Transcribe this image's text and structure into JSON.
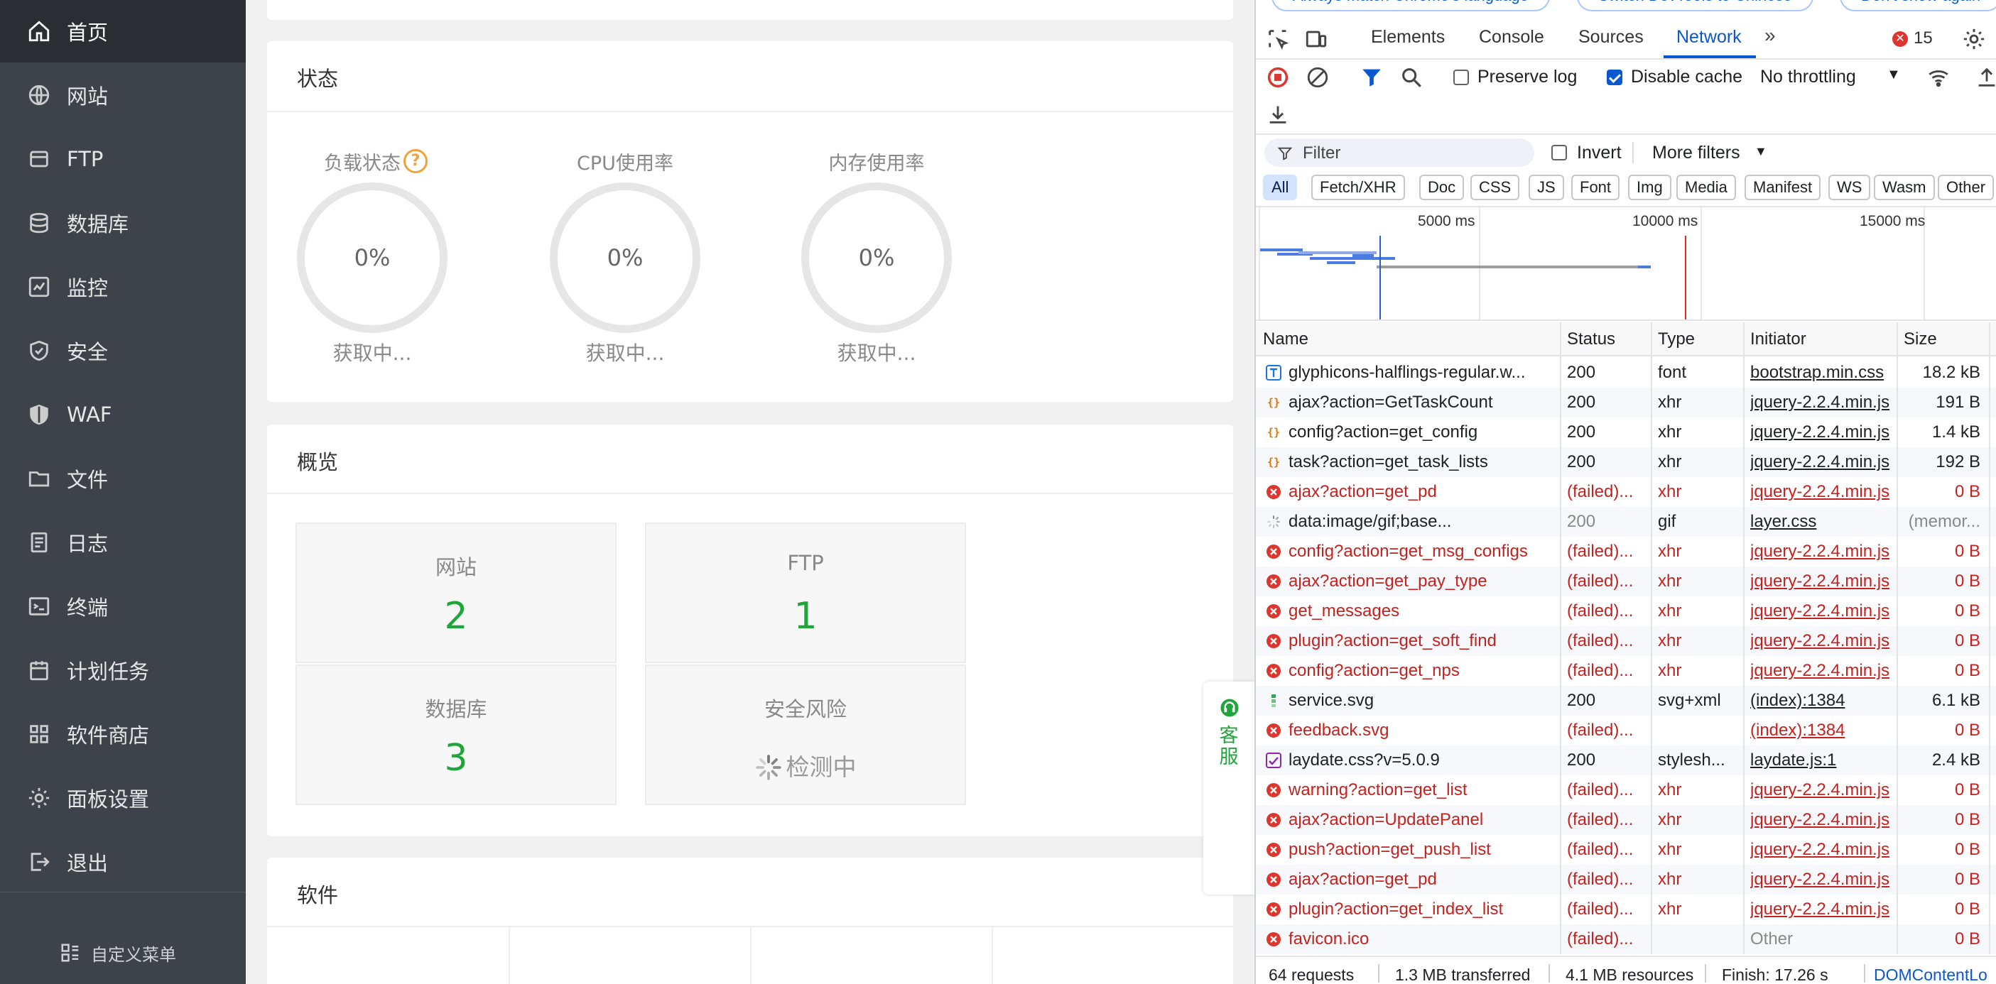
{
  "sidebar": {
    "items": [
      {
        "label": "首页",
        "icon": "home-icon"
      },
      {
        "label": "网站",
        "icon": "globe-icon"
      },
      {
        "label": "FTP",
        "icon": "ftp-icon"
      },
      {
        "label": "数据库",
        "icon": "database-icon"
      },
      {
        "label": "监控",
        "icon": "monitor-icon"
      },
      {
        "label": "安全",
        "icon": "shield-check-icon"
      },
      {
        "label": "WAF",
        "icon": "waf-shield-icon"
      },
      {
        "label": "文件",
        "icon": "folder-icon"
      },
      {
        "label": "日志",
        "icon": "log-icon"
      },
      {
        "label": "终端",
        "icon": "terminal-icon"
      },
      {
        "label": "计划任务",
        "icon": "calendar-icon"
      },
      {
        "label": "软件商店",
        "icon": "grid-icon"
      },
      {
        "label": "面板设置",
        "icon": "gear-icon"
      },
      {
        "label": "退出",
        "icon": "logout-icon"
      }
    ],
    "custom_menu": "自定义菜单"
  },
  "status": {
    "title": "状态",
    "gauges": [
      {
        "title": "负载状态",
        "value": "0%",
        "status": "获取中..."
      },
      {
        "title": "CPU使用率",
        "value": "0%",
        "status": "获取中..."
      },
      {
        "title": "内存使用率",
        "value": "0%",
        "status": "获取中..."
      }
    ]
  },
  "overview": {
    "title": "概览",
    "boxes": [
      {
        "label": "网站",
        "value": "2"
      },
      {
        "label": "FTP",
        "value": "1"
      },
      {
        "label": "数据库",
        "value": "3"
      },
      {
        "label": "安全风险",
        "value": "检测中"
      }
    ]
  },
  "software": {
    "title": "软件"
  },
  "kefu": {
    "text1": "客",
    "text2": "服"
  },
  "devtools": {
    "top_pills": [
      "Always match Chrome's language",
      "Switch DevTools to Chinese",
      "Don't show again"
    ],
    "tabs": [
      "Elements",
      "Console",
      "Sources",
      "Network"
    ],
    "active_tab": "Network",
    "error_count": "15",
    "preserve_log": "Preserve log",
    "disable_cache": "Disable cache",
    "throttling": "No throttling",
    "filter_placeholder": "Filter",
    "invert": "Invert",
    "more_filters": "More filters",
    "type_filters": [
      "All",
      "Fetch/XHR",
      "Doc",
      "CSS",
      "JS",
      "Font",
      "Img",
      "Media",
      "Manifest",
      "WS",
      "Wasm",
      "Other"
    ],
    "timeline_ticks": [
      "5000 ms",
      "10000 ms",
      "15000 ms"
    ],
    "columns": [
      "Name",
      "Status",
      "Type",
      "Initiator",
      "Size"
    ],
    "rows": [
      {
        "name": "glyphicons-halflings-regular.w...",
        "status": "200",
        "type": "font",
        "initiator": "bootstrap.min.css",
        "size": "18.2 kB",
        "kind": "font",
        "failed": false
      },
      {
        "name": "ajax?action=GetTaskCount",
        "status": "200",
        "type": "xhr",
        "initiator": "jquery-2.2.4.min.js",
        "size": "191 B",
        "kind": "xhr",
        "failed": false
      },
      {
        "name": "config?action=get_config",
        "status": "200",
        "type": "xhr",
        "initiator": "jquery-2.2.4.min.js",
        "size": "1.4 kB",
        "kind": "xhr",
        "failed": false
      },
      {
        "name": "task?action=get_task_lists",
        "status": "200",
        "type": "xhr",
        "initiator": "jquery-2.2.4.min.js",
        "size": "192 B",
        "kind": "xhr",
        "failed": false
      },
      {
        "name": "ajax?action=get_pd",
        "status": "(failed)...",
        "type": "xhr",
        "initiator": "jquery-2.2.4.min.js",
        "size": "0 B",
        "kind": "error",
        "failed": true
      },
      {
        "name": "data:image/gif;base...",
        "status": "200",
        "type": "gif",
        "initiator": "layer.css",
        "size": "(memor...",
        "kind": "gif",
        "failed": false
      },
      {
        "name": "config?action=get_msg_configs",
        "status": "(failed)...",
        "type": "xhr",
        "initiator": "jquery-2.2.4.min.js",
        "size": "0 B",
        "kind": "error",
        "failed": true
      },
      {
        "name": "ajax?action=get_pay_type",
        "status": "(failed)...",
        "type": "xhr",
        "initiator": "jquery-2.2.4.min.js",
        "size": "0 B",
        "kind": "error",
        "failed": true
      },
      {
        "name": "get_messages",
        "status": "(failed)...",
        "type": "xhr",
        "initiator": "jquery-2.2.4.min.js",
        "size": "0 B",
        "kind": "error",
        "failed": true
      },
      {
        "name": "plugin?action=get_soft_find",
        "status": "(failed)...",
        "type": "xhr",
        "initiator": "jquery-2.2.4.min.js",
        "size": "0 B",
        "kind": "error",
        "failed": true
      },
      {
        "name": "config?action=get_nps",
        "status": "(failed)...",
        "type": "xhr",
        "initiator": "jquery-2.2.4.min.js",
        "size": "0 B",
        "kind": "error",
        "failed": true
      },
      {
        "name": "service.svg",
        "status": "200",
        "type": "svg+xml",
        "initiator": "(index):1384",
        "size": "6.1 kB",
        "kind": "svg",
        "failed": false
      },
      {
        "name": "feedback.svg",
        "status": "(failed)...",
        "type": "",
        "initiator": "(index):1384",
        "size": "0 B",
        "kind": "error",
        "failed": true
      },
      {
        "name": "laydate.css?v=5.0.9",
        "status": "200",
        "type": "stylesh...",
        "initiator": "laydate.js:1",
        "size": "2.4 kB",
        "kind": "css",
        "failed": false
      },
      {
        "name": "warning?action=get_list",
        "status": "(failed)...",
        "type": "xhr",
        "initiator": "jquery-2.2.4.min.js",
        "size": "0 B",
        "kind": "error",
        "failed": true
      },
      {
        "name": "ajax?action=UpdatePanel",
        "status": "(failed)...",
        "type": "xhr",
        "initiator": "jquery-2.2.4.min.js",
        "size": "0 B",
        "kind": "error",
        "failed": true
      },
      {
        "name": "push?action=get_push_list",
        "status": "(failed)...",
        "type": "xhr",
        "initiator": "jquery-2.2.4.min.js",
        "size": "0 B",
        "kind": "error",
        "failed": true
      },
      {
        "name": "ajax?action=get_pd",
        "status": "(failed)...",
        "type": "xhr",
        "initiator": "jquery-2.2.4.min.js",
        "size": "0 B",
        "kind": "error",
        "failed": true
      },
      {
        "name": "plugin?action=get_index_list",
        "status": "(failed)...",
        "type": "xhr",
        "initiator": "jquery-2.2.4.min.js",
        "size": "0 B",
        "kind": "error",
        "failed": true
      },
      {
        "name": "favicon.ico",
        "status": "(failed)...",
        "type": "",
        "initiator": "Other",
        "size": "0 B",
        "kind": "error",
        "failed": true
      }
    ],
    "statusbar": [
      "64 requests",
      "1.3 MB transferred",
      "4.1 MB resources",
      "Finish: 17.26 s",
      "DOMContentLo"
    ]
  },
  "colors": {
    "accent_green": "#20a53a",
    "devtools_blue": "#0b57d0",
    "error_red": "#dc362e",
    "sidebar_bg": "#3d4349"
  }
}
